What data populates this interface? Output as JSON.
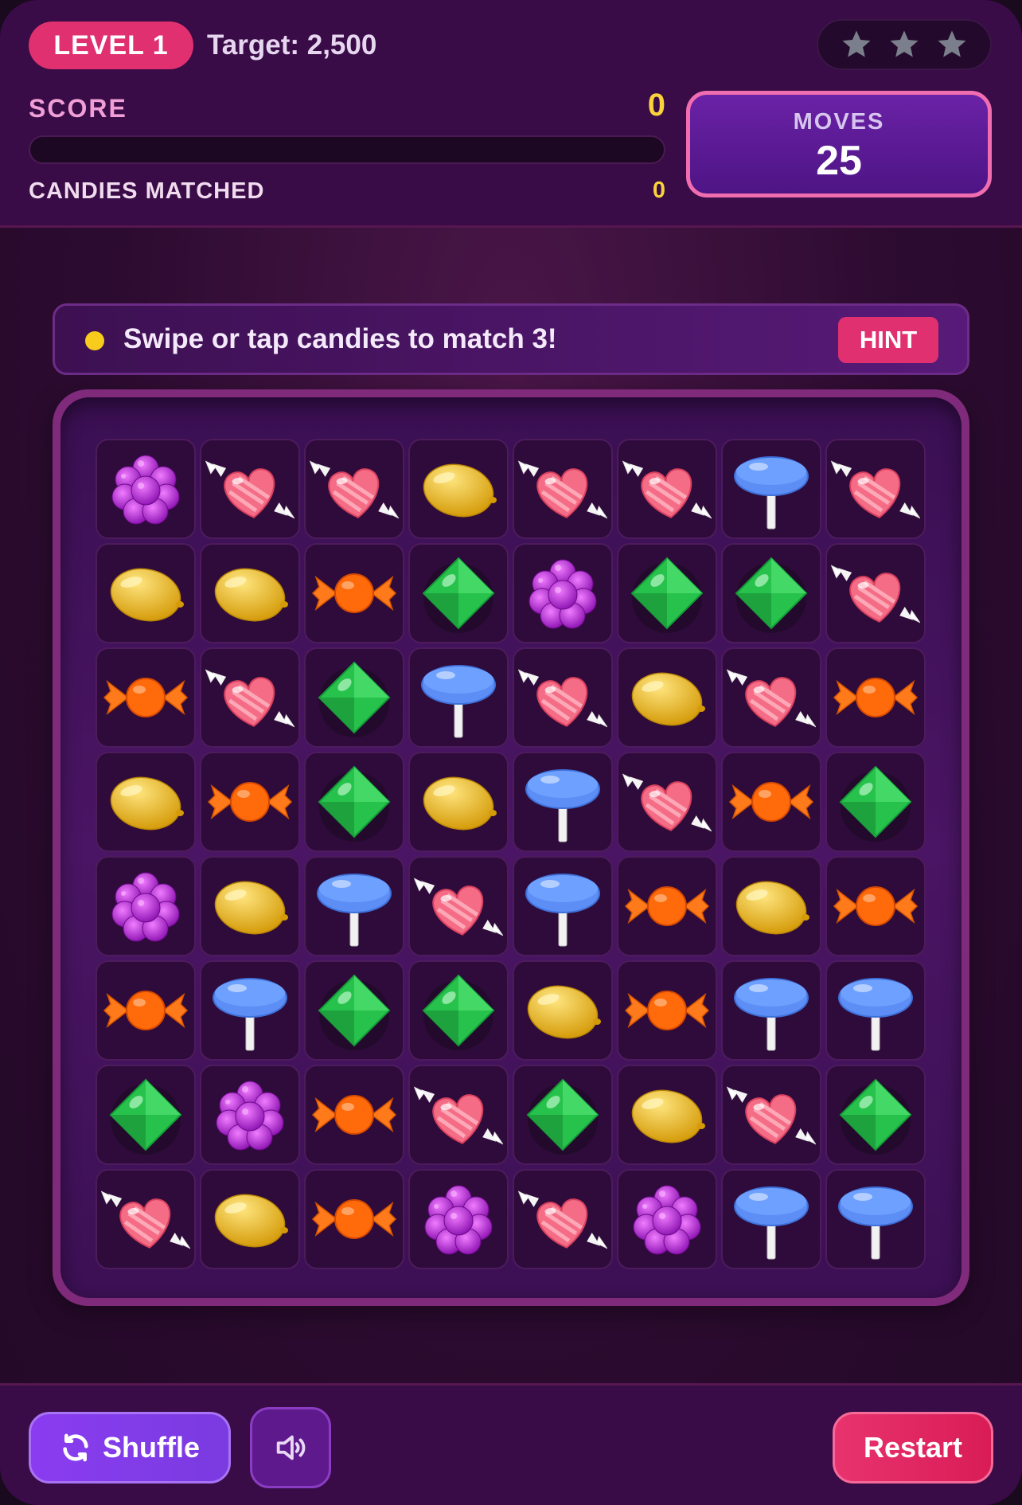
{
  "header": {
    "level_label": "LEVEL 1",
    "target_label": "Target: 2,500",
    "stars_earned": 0,
    "stars_total": 3,
    "score_label": "SCORE",
    "score_value": "0",
    "progress_fraction": 0,
    "candies_matched_label": "CANDIES MATCHED",
    "candies_matched_value": "0",
    "moves_label": "MOVES",
    "moves_value": "25"
  },
  "hint_bar": {
    "message": "Swipe or tap candies to match 3!",
    "hint_button_label": "HINT"
  },
  "board": {
    "rows": 8,
    "cols": 8,
    "grid": [
      [
        "grape",
        "heart",
        "heart",
        "lemon",
        "heart",
        "heart",
        "lollipop",
        "heart"
      ],
      [
        "lemon",
        "lemon",
        "wrapped",
        "gem",
        "grape",
        "gem",
        "gem",
        "heart"
      ],
      [
        "wrapped",
        "heart",
        "gem",
        "lollipop",
        "heart",
        "lemon",
        "heart",
        "wrapped"
      ],
      [
        "lemon",
        "wrapped",
        "gem",
        "lemon",
        "lollipop",
        "heart",
        "wrapped",
        "gem"
      ],
      [
        "grape",
        "lemon",
        "lollipop",
        "heart",
        "lollipop",
        "wrapped",
        "lemon",
        "wrapped"
      ],
      [
        "wrapped",
        "lollipop",
        "gem",
        "gem",
        "lemon",
        "wrapped",
        "lollipop",
        "lollipop"
      ],
      [
        "gem",
        "grape",
        "wrapped",
        "heart",
        "gem",
        "lemon",
        "heart",
        "gem"
      ],
      [
        "heart",
        "lemon",
        "wrapped",
        "grape",
        "heart",
        "grape",
        "lollipop",
        "lollipop"
      ]
    ],
    "candy_icons": {
      "grape": "purple-grape-candy-icon",
      "heart": "pink-heart-candy-icon",
      "lemon": "yellow-lemon-candy-icon",
      "lollipop": "blue-lollipop-icon",
      "wrapped": "orange-wrapped-candy-icon",
      "gem": "green-gem-candy-icon"
    }
  },
  "footer": {
    "shuffle_label": "Shuffle",
    "restart_label": "Restart",
    "sound_icon": "speaker-icon",
    "shuffle_icon": "refresh-icon"
  },
  "colors": {
    "accent_pink": "#e0306f",
    "score_yellow": "#f8d33a",
    "moves_border": "#f06db0",
    "shuffle_purple": "#8a3cf0",
    "background": "#2c0b30"
  }
}
